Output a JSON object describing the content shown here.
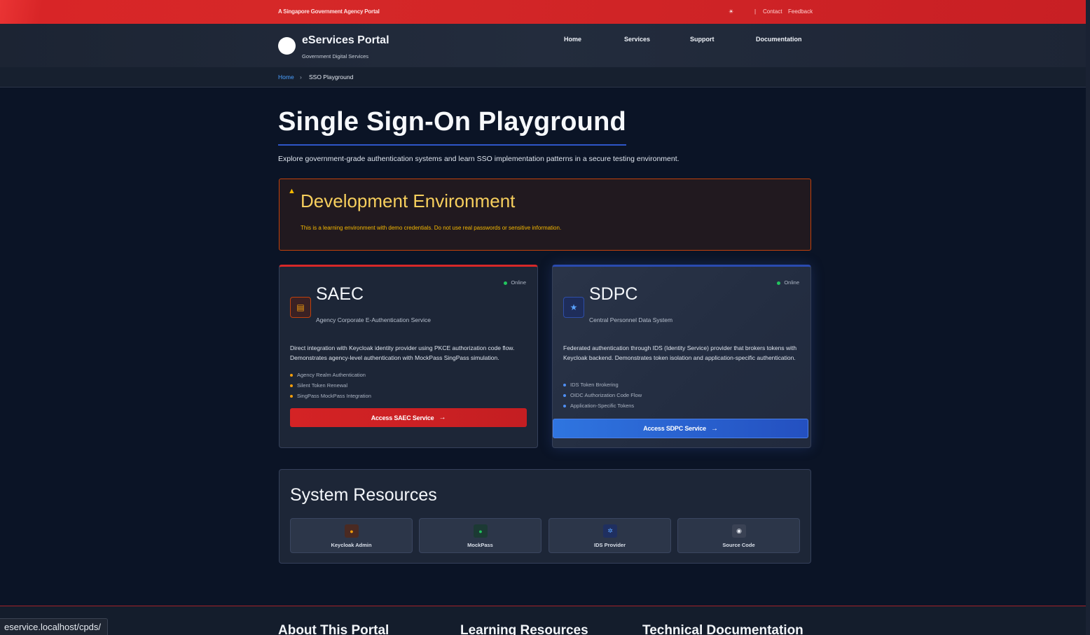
{
  "gov_bar": {
    "text": "A Singapore Government Agency Portal",
    "theme_icon": "sun-icon",
    "separator": "|",
    "contact": "Contact",
    "feedback": "Feedback"
  },
  "header": {
    "brand": "eServices Portal",
    "brand_sub": "Government Digital Services",
    "nav": [
      "Home",
      "Services",
      "Support",
      "Documentation"
    ]
  },
  "breadcrumb": {
    "home": "Home",
    "separator": "›",
    "current": "SSO Playground"
  },
  "page": {
    "title": "Single Sign-On Playground",
    "description": "Explore government-grade authentication systems and learn SSO implementation patterns in a secure testing environment."
  },
  "warning": {
    "icon": "warning-icon",
    "title": "Development Environment",
    "text": "This is a learning environment with demo credentials. Do not use real passwords or sensitive information."
  },
  "cards": [
    {
      "title": "SAEC",
      "subtitle": "Agency Corporate E-Authentication Service",
      "status": "Online",
      "icon": "document-icon",
      "description": "Direct integration with Keycloak identity provider using PKCE authorization code flow. Demonstrates agency-level authentication with MockPass SingPass simulation.",
      "features": [
        "Agency Realm Authentication",
        "Silent Token Renewal",
        "SingPass MockPass Integration"
      ],
      "button": "Access SAEC Service",
      "accent": "#d62828"
    },
    {
      "title": "SDPC",
      "subtitle": "Central Personnel Data System",
      "status": "Online",
      "icon": "star-icon",
      "description": "Federated authentication through IDS (Identity Service) provider that brokers tokens with Keycloak backend. Demonstrates token isolation and application-specific authentication.",
      "features": [
        "IDS Token Brokering",
        "OIDC Authorization Code Flow",
        "Application-Specific Tokens"
      ],
      "button": "Access SDPC Service",
      "accent": "#2f75e0"
    }
  ],
  "resources": {
    "title": "System Resources",
    "items": [
      {
        "label": "Keycloak Admin",
        "icon": "user-shield-icon"
      },
      {
        "label": "MockPass",
        "icon": "check-circle-icon"
      },
      {
        "label": "IDS Provider",
        "icon": "gear-icon"
      },
      {
        "label": "Source Code",
        "icon": "github-icon"
      }
    ]
  },
  "footer": {
    "headings": [
      "About This Portal",
      "Learning Resources",
      "Technical Documentation"
    ]
  },
  "status_bar": {
    "url": "eservice.localhost/cpds/"
  }
}
